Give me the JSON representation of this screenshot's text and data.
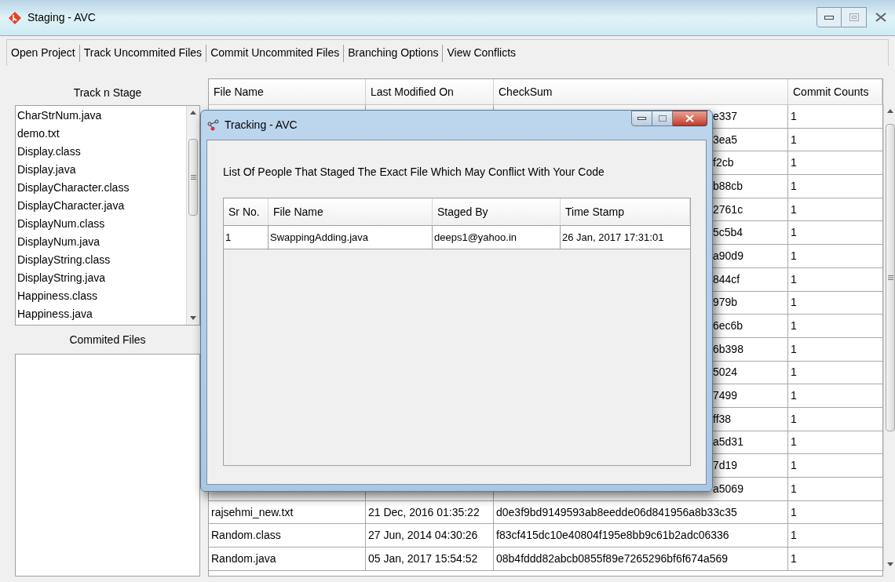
{
  "window": {
    "title": "Staging - AVC"
  },
  "menu": [
    {
      "label": "Open Project"
    },
    {
      "label": "Track Uncommited Files"
    },
    {
      "label": "Commit Uncommited Files"
    },
    {
      "label": "Branching Options"
    },
    {
      "label": "View Conflicts"
    }
  ],
  "left_panel": {
    "track_title": "Track n Stage",
    "track_files": [
      "CharStrNum.java",
      "demo.txt",
      "Display.class",
      "Display.java",
      "DisplayCharacter.class",
      "DisplayCharacter.java",
      "DisplayNum.class",
      "DisplayNum.java",
      "DisplayString.class",
      "DisplayString.java",
      "Happiness.class",
      "Happiness.java"
    ],
    "committed_title": "Commited Files"
  },
  "table": {
    "columns": [
      "File Name",
      "Last Modified On",
      "CheckSum",
      "Commit Counts"
    ],
    "rows": [
      {
        "checksum": "e337",
        "commit_count": "1"
      },
      {
        "checksum": "3ea5",
        "commit_count": "1"
      },
      {
        "checksum": "f2cb",
        "commit_count": "1"
      },
      {
        "checksum": "b88cb",
        "commit_count": "1"
      },
      {
        "checksum": "2761c",
        "commit_count": "1"
      },
      {
        "checksum": "5c5b4",
        "commit_count": "1"
      },
      {
        "checksum": "a90d9",
        "commit_count": "1"
      },
      {
        "checksum": "844cf",
        "commit_count": "1"
      },
      {
        "checksum": "979b",
        "commit_count": "1"
      },
      {
        "checksum": "6ec6b",
        "commit_count": "1"
      },
      {
        "checksum": "6b398",
        "commit_count": "1"
      },
      {
        "checksum": "5024",
        "commit_count": "1"
      },
      {
        "checksum": "7499",
        "commit_count": "1"
      },
      {
        "checksum": "ff38",
        "commit_count": "1"
      },
      {
        "checksum": "a5d31",
        "commit_count": "1"
      },
      {
        "checksum": "7d19",
        "commit_count": "1"
      },
      {
        "checksum": "a5069",
        "commit_count": "1"
      },
      {
        "file_name": "rajsehmi_new.txt",
        "last_modified": "21 Dec, 2016 01:35:22",
        "checksum": "d0e3f9bd9149593ab8eedde06d841956a8b33c35",
        "commit_count": "1"
      },
      {
        "file_name": "Random.class",
        "last_modified": "27 Jun, 2014 04:30:26",
        "checksum": "f83cf415dc10e40804f195e8bb9c61b2adc06336",
        "commit_count": "1"
      },
      {
        "file_name": "Random.java",
        "last_modified": "05 Jan, 2017 15:54:52",
        "checksum": "08b4fddd82abcb0855f89e7265296bf6f674a569",
        "commit_count": "1"
      }
    ]
  },
  "dialog": {
    "title": "Tracking - AVC",
    "message": "List Of People That Staged The Exact File Which May Conflict With Your Code",
    "table": {
      "columns": [
        "Sr No.",
        "File Name",
        "Staged By",
        "Time Stamp"
      ],
      "rows": [
        {
          "sr_no": "1",
          "file_name": "SwappingAdding.java",
          "staged_by": "deeps1@yahoo.in",
          "time_stamp": "26 Jan, 2017 17:31:01"
        }
      ]
    }
  }
}
